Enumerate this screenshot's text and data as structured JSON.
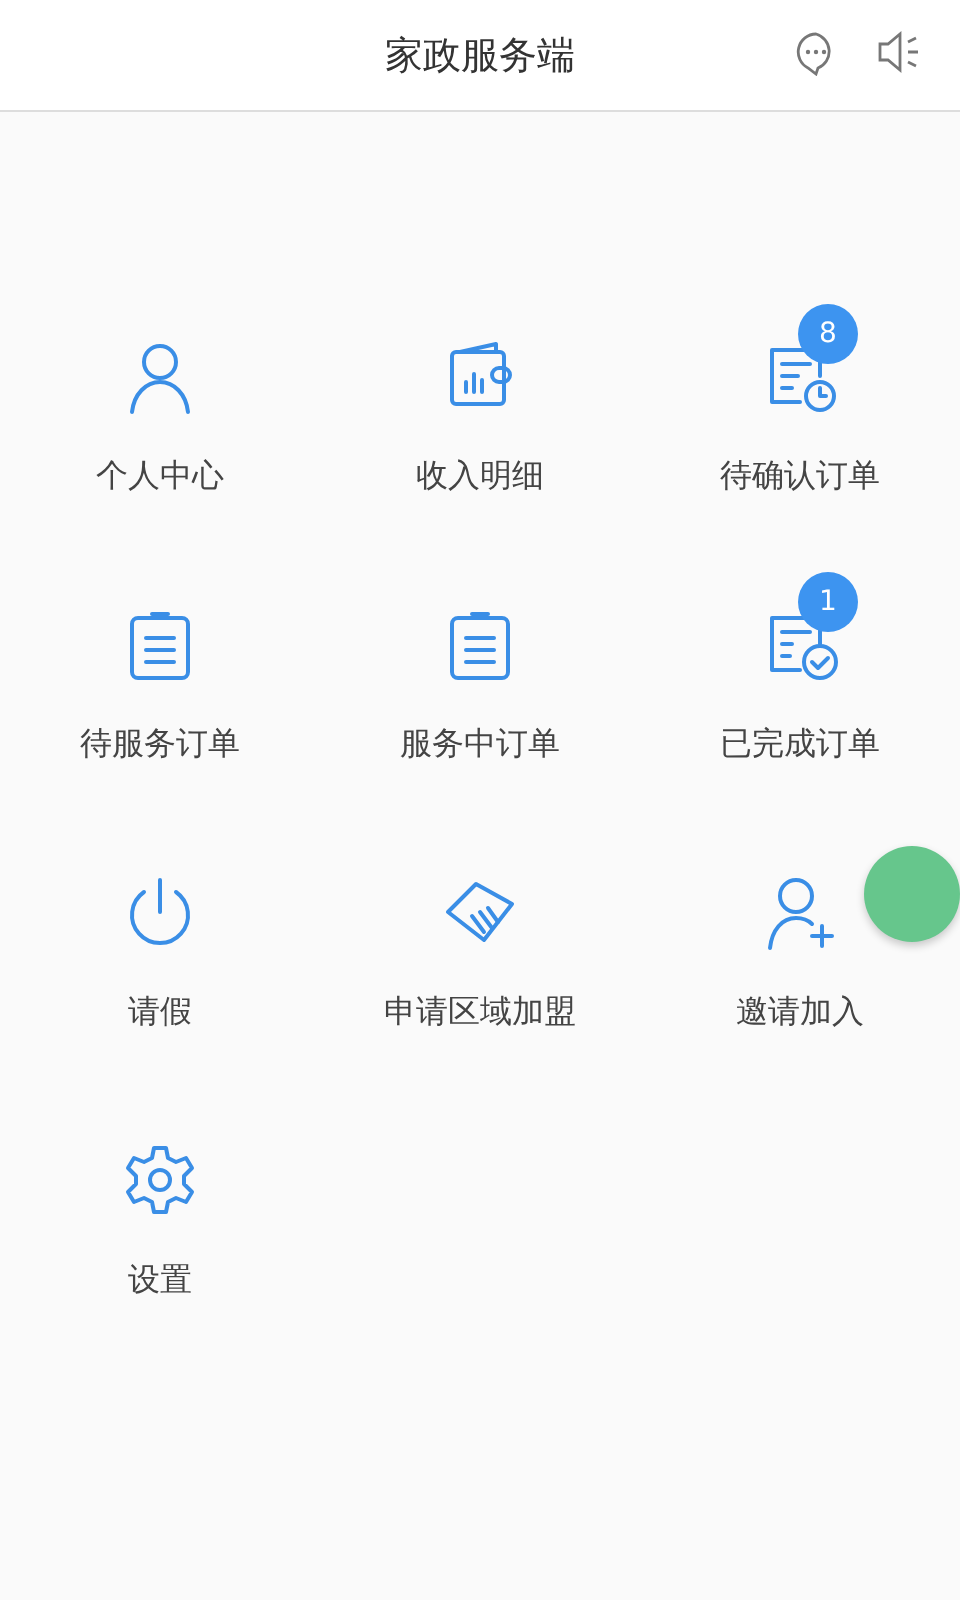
{
  "header": {
    "title": "家政服务端"
  },
  "menu": [
    {
      "label": "个人中心"
    },
    {
      "label": "收入明细"
    },
    {
      "label": "待确认订单",
      "badge": "8"
    },
    {
      "label": "待服务订单"
    },
    {
      "label": "服务中订单"
    },
    {
      "label": "已完成订单",
      "badge": "1"
    },
    {
      "label": "请假"
    },
    {
      "label": "申请区域加盟"
    },
    {
      "label": "邀请加入"
    },
    {
      "label": "设置"
    }
  ]
}
